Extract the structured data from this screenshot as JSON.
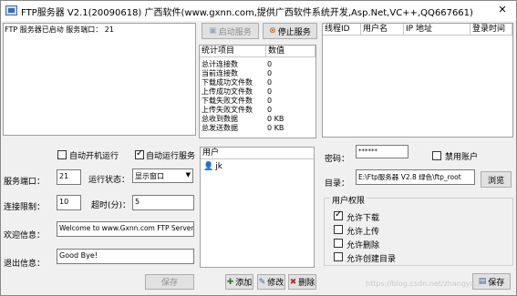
{
  "window": {
    "title": "FTP服务器 V2.1(20090618)  广西软件(www.gxnn.com,提供广西软件系统开发,Asp.Net,VC++,QQ667661)"
  },
  "status_log": {
    "text": "FTP 服务器已启动 服务端口： 21"
  },
  "toolbar": {
    "start_label": "启动服务",
    "stop_label": "停止服务"
  },
  "stats": {
    "headers": [
      "统计项目",
      "数值"
    ],
    "rows": [
      {
        "k": "总计连接数",
        "v": "0"
      },
      {
        "k": "当前连接数",
        "v": "0"
      },
      {
        "k": "下载成功文件数",
        "v": "0"
      },
      {
        "k": "上传成功文件数",
        "v": "0"
      },
      {
        "k": "下载失败文件数",
        "v": "0"
      },
      {
        "k": "上传失败文件数",
        "v": "0"
      },
      {
        "k": "总收到数据",
        "v": "0 KB"
      },
      {
        "k": "总发送数据",
        "v": "0 KB"
      }
    ]
  },
  "threads": {
    "headers": [
      "线程ID",
      "用户名",
      "IP 地址",
      "登录时间"
    ]
  },
  "settings": {
    "auto_boot_label": "自动开机运行",
    "auto_run_label": "自动运行服务",
    "port_label": "服务端口：",
    "port_value": "21",
    "run_state_label": "运行状态：",
    "run_state_value": "显示窗口",
    "conn_limit_label": "连接限制：",
    "conn_limit_value": "10",
    "timeout_label": "超时(分)：",
    "timeout_value": "5",
    "welcome_label": "欢迎信息：",
    "welcome_value": "Welcome to www.Gxnn.com FTP Server!",
    "exit_label": "退出信息：",
    "exit_value": "Good Bye!",
    "save_label": "保存"
  },
  "users": {
    "header": "用户",
    "items": [
      "jk"
    ],
    "add_label": "添加",
    "edit_label": "修改",
    "delete_label": "删除"
  },
  "account": {
    "password_label": "密码：",
    "password_value": "******",
    "disable_label": "禁用账户",
    "dir_label": "目录：",
    "dir_value": "E:\\Ftp服务器 V2.8 绿色\\ftp_root",
    "browse_label": "浏览",
    "perm_group_label": "用户权限",
    "perms": [
      {
        "label": "允许下载",
        "checked": true
      },
      {
        "label": "允许上传",
        "checked": false
      },
      {
        "label": "允许删除",
        "checked": false
      },
      {
        "label": "允许创建目录",
        "checked": false
      }
    ],
    "save_label": "保存"
  },
  "watermark": "https://blog.csdn.net/zhangyx..."
}
